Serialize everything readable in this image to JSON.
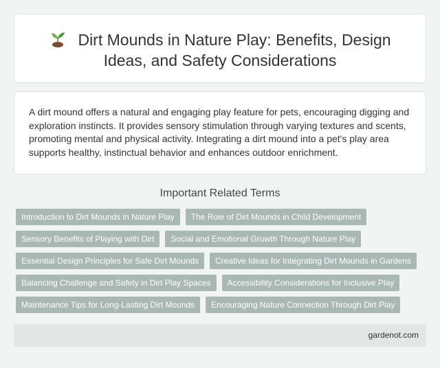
{
  "header": {
    "icon": "seedling-icon",
    "title": "Dirt Mounds in Nature Play: Benefits, Design Ideas, and Safety Considerations"
  },
  "description": "A dirt mound offers a natural and engaging play feature for pets, encouraging digging and exploration instincts. It provides sensory stimulation through varying textures and scents, promoting mental and physical activity. Integrating a dirt mound into a pet's play area supports healthy, instinctual behavior and enhances outdoor enrichment.",
  "related": {
    "heading": "Important Related Terms",
    "terms": [
      "Introduction to Dirt Mounds in Nature Play",
      "The Role of Dirt Mounds in Child Development",
      "Sensory Benefits of Playing with Dirt",
      "Social and Emotional Growth Through Nature Play",
      "Essential Design Principles for Safe Dirt Mounds",
      "Creative Ideas for Integrating Dirt Mounds in Gardens",
      "Balancing Challenge and Safety in Dirt Play Spaces",
      "Accessibility Considerations for Inclusive Play",
      "Maintenance Tips for Long-Lasting Dirt Mounds",
      "Encouraging Nature Connection Through Dirt Play"
    ]
  },
  "footer": {
    "site": "gardenot.com"
  },
  "colors": {
    "tag_bg": "#a9b8b4",
    "page_bg": "#f0f5f3",
    "footer_bg": "#e0e7e4"
  }
}
